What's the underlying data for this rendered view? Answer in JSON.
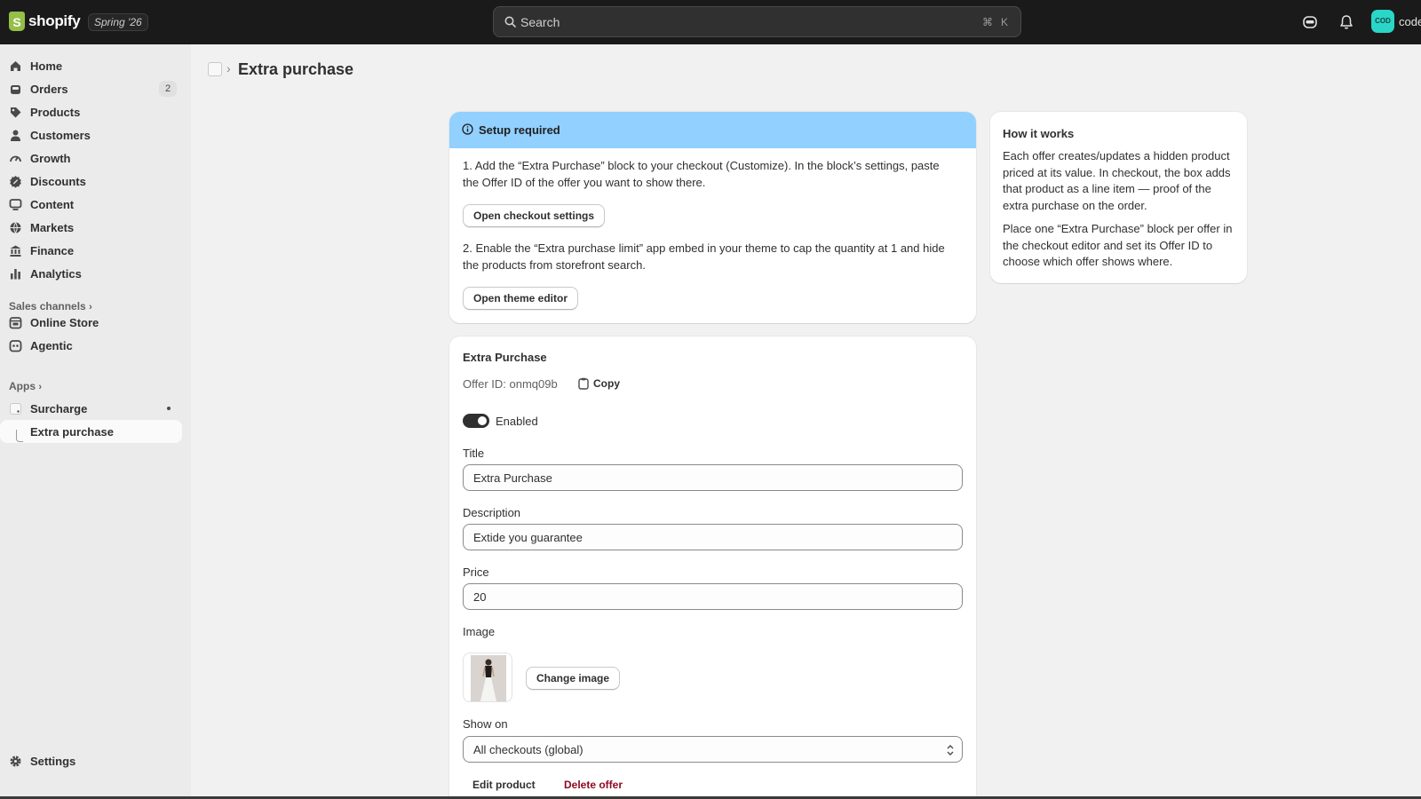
{
  "topbar": {
    "brand": "shopify",
    "edition": "Spring '26",
    "search_placeholder": "Search",
    "shortcut_key1": "⌘",
    "shortcut_key2": "K",
    "avatar_initials": "COD",
    "store_name": "code"
  },
  "sidebar": {
    "items": [
      {
        "label": "Home",
        "icon": "home-icon"
      },
      {
        "label": "Orders",
        "icon": "orders-icon",
        "badge": "2"
      },
      {
        "label": "Products",
        "icon": "tag-icon"
      },
      {
        "label": "Customers",
        "icon": "person-icon"
      },
      {
        "label": "Growth",
        "icon": "gauge-icon"
      },
      {
        "label": "Discounts",
        "icon": "discount-icon"
      },
      {
        "label": "Content",
        "icon": "monitor-icon"
      },
      {
        "label": "Markets",
        "icon": "globe-icon"
      },
      {
        "label": "Finance",
        "icon": "bank-icon"
      },
      {
        "label": "Analytics",
        "icon": "bar-chart-icon"
      }
    ],
    "sales_channels_label": "Sales channels",
    "channels": [
      {
        "label": "Online Store",
        "icon": "store-icon"
      },
      {
        "label": "Agentic",
        "icon": "agent-icon"
      }
    ],
    "apps_label": "Apps",
    "apps": [
      {
        "label": "Surcharge",
        "icon": "app-icon"
      },
      {
        "label": "Extra purchase"
      }
    ],
    "settings_label": "Settings"
  },
  "header": {
    "title": "Extra purchase"
  },
  "setup_banner": {
    "title": "Setup required",
    "step1": "1. Add the “Extra Purchase” block to your checkout (Customize). In the block’s settings, paste the Offer ID of the offer you want to show there.",
    "button1": "Open checkout settings",
    "step2": "2. Enable the “Extra purchase limit” app embed in your theme to cap the quantity at 1 and hide the products from storefront search.",
    "button2": "Open theme editor"
  },
  "offer": {
    "heading": "Extra Purchase",
    "offer_id_text": "Offer ID: onmq09b",
    "copy_label": "Copy",
    "enabled_label": "Enabled",
    "enabled": true,
    "title_label": "Title",
    "title_value": "Extra Purchase",
    "description_label": "Description",
    "description_value": "Extide you guarantee",
    "price_label": "Price",
    "price_value": "20",
    "image_label": "Image",
    "change_image_label": "Change image",
    "show_on_label": "Show on",
    "show_on_value": "All checkouts (global)",
    "edit_product_label": "Edit product",
    "delete_offer_label": "Delete offer"
  },
  "how_it_works": {
    "title": "How it works",
    "p1": "Each offer creates/updates a hidden product priced at its value. In checkout, the box adds that product as a line item — proof of the extra purchase on the order.",
    "p2": "Place one “Extra Purchase” block per offer in the checkout editor and set its Offer ID to choose which offer shows where."
  },
  "colors": {
    "topbar_bg": "#1a1a1a",
    "banner_bg": "#91d0ff",
    "critical": "#8e0b21",
    "avatar_bg": "#2ad6c7"
  }
}
